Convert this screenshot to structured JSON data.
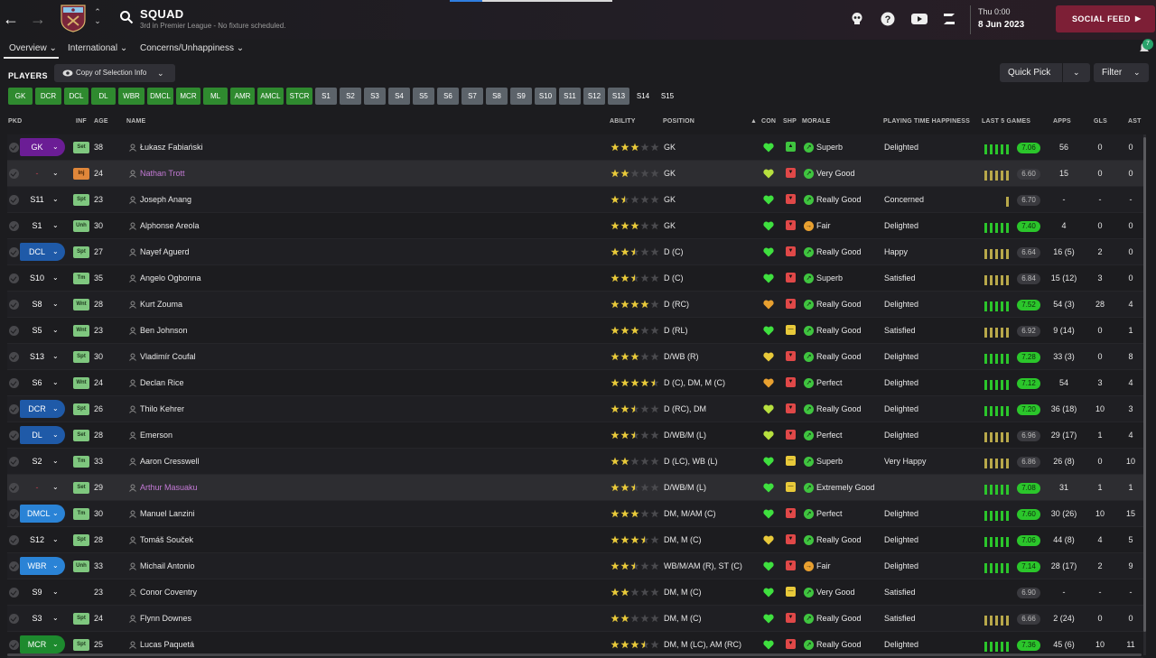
{
  "header": {
    "title": "SQUAD",
    "subtitle": "3rd in Premier League - No fixture scheduled.",
    "day": "Thu 0:00",
    "date": "8 Jun 2023",
    "social_feed": "SOCIAL FEED",
    "notifications_count": "7"
  },
  "tabs": [
    "Overview",
    "International",
    "Concerns/Unhappiness"
  ],
  "toolbar": {
    "players_label": "PLAYERS",
    "selection_info": "Copy of Selection Info",
    "quick_pick": "Quick Pick",
    "filter": "Filter"
  },
  "position_chips": [
    {
      "label": "GK",
      "style": "green"
    },
    {
      "label": "DCR",
      "style": "green"
    },
    {
      "label": "DCL",
      "style": "green"
    },
    {
      "label": "DL",
      "style": "green"
    },
    {
      "label": "WBR",
      "style": "green"
    },
    {
      "label": "DMCL",
      "style": "green"
    },
    {
      "label": "MCR",
      "style": "green"
    },
    {
      "label": "ML",
      "style": "green"
    },
    {
      "label": "AMR",
      "style": "green"
    },
    {
      "label": "AMCL",
      "style": "green"
    },
    {
      "label": "STCR",
      "style": "green"
    },
    {
      "label": "S1",
      "style": "grey"
    },
    {
      "label": "S2",
      "style": "grey"
    },
    {
      "label": "S3",
      "style": "grey"
    },
    {
      "label": "S4",
      "style": "grey"
    },
    {
      "label": "S5",
      "style": "grey"
    },
    {
      "label": "S6",
      "style": "grey"
    },
    {
      "label": "S7",
      "style": "grey"
    },
    {
      "label": "S8",
      "style": "grey"
    },
    {
      "label": "S9",
      "style": "grey"
    },
    {
      "label": "S10",
      "style": "grey"
    },
    {
      "label": "S11",
      "style": "grey"
    },
    {
      "label": "S12",
      "style": "grey"
    },
    {
      "label": "S13",
      "style": "grey"
    },
    {
      "label": "S14",
      "style": "dark"
    },
    {
      "label": "S15",
      "style": "dark"
    }
  ],
  "columns": {
    "pkd": "PKD",
    "inf": "INF",
    "age": "AGE",
    "name": "NAME",
    "ability": "ABILITY",
    "position": "POSITION",
    "con": "CON",
    "shp": "SHP",
    "morale": "MORALE",
    "happiness": "PLAYING TIME HAPPINESS",
    "last5": "LAST 5 GAMES",
    "apps": "APPS",
    "gls": "GLS",
    "ast": "AST"
  },
  "colors": {
    "green": "#2bc62b",
    "social": "#7d1f36",
    "gk_slot": "#6b1d95",
    "def_slot": "#1f5aa8",
    "wb_slot": "#2a83d6",
    "mid_slot": "#1d8a2e",
    "unavailable_name": "#c47ad6"
  },
  "players": [
    {
      "pkd": "GK",
      "pkd_style": "gk",
      "inf": "Set",
      "age": "38",
      "name": "Łukasz Fabiański",
      "stars": 3,
      "position": "GK",
      "con": "green",
      "shp": "green",
      "morale_icon": "green",
      "morale": "Superb",
      "happiness": "Delighted",
      "form": [
        "g",
        "g",
        "g",
        "g",
        "g"
      ],
      "rating": "7.06",
      "rating_style": "green",
      "apps": "56",
      "gls": "0",
      "ast": "0",
      "name_style": "normal"
    },
    {
      "pkd": "-",
      "pkd_style": "plain",
      "inf": "Inj",
      "age": "24",
      "name": "Nathan Trott",
      "stars": 2,
      "position": "GK",
      "con": "yellowgreen",
      "shp": "red",
      "morale_icon": "green",
      "morale": "Very Good",
      "happiness": "",
      "form": [
        "y",
        "y",
        "y",
        "y",
        "y"
      ],
      "rating": "6.60",
      "rating_style": "grey",
      "apps": "15",
      "gls": "0",
      "ast": "0",
      "name_style": "unavail",
      "row_style": "highlight"
    },
    {
      "pkd": "S11",
      "pkd_style": "plain",
      "inf": "Spt",
      "age": "23",
      "name": "Joseph Anang",
      "stars": 1.5,
      "position": "GK",
      "con": "green",
      "shp": "red",
      "morale_icon": "green",
      "morale": "Really Good",
      "happiness": "Concerned",
      "form": [
        "y"
      ],
      "rating": "6.70",
      "rating_style": "grey",
      "apps": "-",
      "gls": "-",
      "ast": "-",
      "name_style": "normal"
    },
    {
      "pkd": "S1",
      "pkd_style": "plain",
      "inf": "Unh",
      "age": "30",
      "name": "Alphonse Areola",
      "stars": 3,
      "position": "GK",
      "con": "green",
      "shp": "red",
      "morale_icon": "orange",
      "morale": "Fair",
      "happiness": "Delighted",
      "form": [
        "g",
        "g",
        "g",
        "g",
        "g"
      ],
      "rating": "7.40",
      "rating_style": "green",
      "apps": "4",
      "gls": "0",
      "ast": "0",
      "name_style": "normal"
    },
    {
      "pkd": "DCL",
      "pkd_style": "def",
      "inf": "Spt",
      "age": "27",
      "name": "Nayef Aguerd",
      "stars": 2.5,
      "position": "D (C)",
      "con": "green",
      "shp": "red",
      "morale_icon": "green",
      "morale": "Really Good",
      "happiness": "Happy",
      "form": [
        "y",
        "y",
        "y",
        "y",
        "y"
      ],
      "rating": "6.64",
      "rating_style": "grey",
      "apps": "16 (5)",
      "gls": "2",
      "ast": "0",
      "name_style": "normal"
    },
    {
      "pkd": "S10",
      "pkd_style": "plain",
      "inf": "Tm",
      "age": "35",
      "name": "Angelo Ogbonna",
      "stars": 2.5,
      "position": "D (C)",
      "con": "green",
      "shp": "red",
      "morale_icon": "green",
      "morale": "Superb",
      "happiness": "Satisfied",
      "form": [
        "y",
        "y",
        "y",
        "y",
        "y"
      ],
      "rating": "6.84",
      "rating_style": "grey",
      "apps": "15 (12)",
      "gls": "3",
      "ast": "0",
      "name_style": "normal"
    },
    {
      "pkd": "S8",
      "pkd_style": "plain",
      "inf": "Wnt",
      "age": "28",
      "name": "Kurt Zouma",
      "stars": 4,
      "position": "D (RC)",
      "con": "orange",
      "shp": "red",
      "morale_icon": "green",
      "morale": "Really Good",
      "happiness": "Delighted",
      "form": [
        "g",
        "g",
        "g",
        "g",
        "g"
      ],
      "rating": "7.52",
      "rating_style": "green",
      "apps": "54 (3)",
      "gls": "28",
      "ast": "4",
      "name_style": "normal"
    },
    {
      "pkd": "S5",
      "pkd_style": "plain",
      "inf": "Wnt",
      "age": "23",
      "name": "Ben Johnson",
      "stars": 3,
      "position": "D (RL)",
      "con": "green",
      "shp": "yellow",
      "morale_icon": "green",
      "morale": "Really Good",
      "happiness": "Satisfied",
      "form": [
        "y",
        "y",
        "y",
        "y",
        "y"
      ],
      "rating": "6.92",
      "rating_style": "grey",
      "apps": "9 (14)",
      "gls": "0",
      "ast": "1",
      "name_style": "normal"
    },
    {
      "pkd": "S13",
      "pkd_style": "plain",
      "inf": "Spt",
      "age": "30",
      "name": "Vladimír Coufal",
      "stars": 3,
      "position": "D/WB (R)",
      "con": "yellow",
      "shp": "red",
      "morale_icon": "green",
      "morale": "Really Good",
      "happiness": "Delighted",
      "form": [
        "g",
        "g",
        "g",
        "g",
        "g"
      ],
      "rating": "7.28",
      "rating_style": "green",
      "apps": "33 (3)",
      "gls": "0",
      "ast": "8",
      "name_style": "normal"
    },
    {
      "pkd": "S6",
      "pkd_style": "plain",
      "inf": "Wnt",
      "age": "24",
      "name": "Declan Rice",
      "stars": 4.5,
      "position": "D (C), DM, M (C)",
      "con": "orange",
      "shp": "red",
      "morale_icon": "green",
      "morale": "Perfect",
      "happiness": "Delighted",
      "form": [
        "g",
        "g",
        "g",
        "g",
        "g"
      ],
      "rating": "7.12",
      "rating_style": "green",
      "apps": "54",
      "gls": "3",
      "ast": "4",
      "name_style": "normal"
    },
    {
      "pkd": "DCR",
      "pkd_style": "def",
      "inf": "Spt",
      "age": "26",
      "name": "Thilo Kehrer",
      "stars": 2.5,
      "position": "D (RC), DM",
      "con": "yellowgreen",
      "shp": "red",
      "morale_icon": "green",
      "morale": "Really Good",
      "happiness": "Delighted",
      "form": [
        "g",
        "g",
        "g",
        "g",
        "g"
      ],
      "rating": "7.20",
      "rating_style": "green",
      "apps": "36 (18)",
      "gls": "10",
      "ast": "3",
      "name_style": "normal"
    },
    {
      "pkd": "DL",
      "pkd_style": "def",
      "inf": "Set",
      "age": "28",
      "name": "Emerson",
      "stars": 2.5,
      "position": "D/WB/M (L)",
      "con": "yellowgreen",
      "shp": "red",
      "morale_icon": "green",
      "morale": "Perfect",
      "happiness": "Delighted",
      "form": [
        "y",
        "y",
        "y",
        "y",
        "y"
      ],
      "rating": "6.96",
      "rating_style": "grey",
      "apps": "29 (17)",
      "gls": "1",
      "ast": "4",
      "name_style": "normal"
    },
    {
      "pkd": "S2",
      "pkd_style": "plain",
      "inf": "Tm",
      "age": "33",
      "name": "Aaron Cresswell",
      "stars": 2,
      "position": "D (LC), WB (L)",
      "con": "green",
      "shp": "yellow",
      "morale_icon": "green",
      "morale": "Superb",
      "happiness": "Very Happy",
      "form": [
        "y",
        "y",
        "y",
        "y",
        "y"
      ],
      "rating": "6.86",
      "rating_style": "grey",
      "apps": "26 (8)",
      "gls": "0",
      "ast": "10",
      "name_style": "normal"
    },
    {
      "pkd": "-",
      "pkd_style": "plain",
      "inf": "Set",
      "age": "29",
      "name": "Arthur Masuaku",
      "stars": 2.5,
      "position": "D/WB/M (L)",
      "con": "green",
      "shp": "yellow",
      "morale_icon": "green",
      "morale": "Extremely Good",
      "happiness": "",
      "form": [
        "g",
        "g",
        "g",
        "g",
        "g"
      ],
      "rating": "7.08",
      "rating_style": "green",
      "apps": "31",
      "gls": "1",
      "ast": "1",
      "name_style": "unavail",
      "row_style": "highlight"
    },
    {
      "pkd": "DMCL",
      "pkd_style": "wb",
      "inf": "Tm",
      "age": "30",
      "name": "Manuel Lanzini",
      "stars": 3,
      "position": "DM, M/AM (C)",
      "con": "green",
      "shp": "red",
      "morale_icon": "green",
      "morale": "Perfect",
      "happiness": "Delighted",
      "form": [
        "g",
        "g",
        "g",
        "g",
        "g"
      ],
      "rating": "7.60",
      "rating_style": "green",
      "apps": "30 (26)",
      "gls": "10",
      "ast": "15",
      "name_style": "normal"
    },
    {
      "pkd": "S12",
      "pkd_style": "plain",
      "inf": "Spt",
      "age": "28",
      "name": "Tomáš Souček",
      "stars": 3.5,
      "position": "DM, M (C)",
      "con": "yellow",
      "shp": "red",
      "morale_icon": "green",
      "morale": "Really Good",
      "happiness": "Delighted",
      "form": [
        "g",
        "g",
        "g",
        "g",
        "g"
      ],
      "rating": "7.06",
      "rating_style": "green",
      "apps": "44 (8)",
      "gls": "4",
      "ast": "5",
      "name_style": "normal"
    },
    {
      "pkd": "WBR",
      "pkd_style": "wb",
      "inf": "Unh",
      "age": "33",
      "name": "Michail Antonio",
      "stars": 2.5,
      "position": "WB/M/AM (R), ST (C)",
      "con": "green",
      "shp": "red",
      "morale_icon": "orange",
      "morale": "Fair",
      "happiness": "Delighted",
      "form": [
        "g",
        "g",
        "g",
        "g",
        "g"
      ],
      "rating": "7.14",
      "rating_style": "green",
      "apps": "28 (17)",
      "gls": "2",
      "ast": "9",
      "name_style": "normal"
    },
    {
      "pkd": "S9",
      "pkd_style": "plain",
      "inf": "",
      "age": "23",
      "name": "Conor Coventry",
      "stars": 2,
      "position": "DM, M (C)",
      "con": "green",
      "shp": "yellow",
      "morale_icon": "green",
      "morale": "Very Good",
      "happiness": "Satisfied",
      "form": [],
      "rating": "6.90",
      "rating_style": "grey",
      "apps": "-",
      "gls": "-",
      "ast": "-",
      "name_style": "normal"
    },
    {
      "pkd": "S3",
      "pkd_style": "plain",
      "inf": "Spt",
      "age": "24",
      "name": "Flynn Downes",
      "stars": 2,
      "position": "DM, M (C)",
      "con": "green",
      "shp": "red",
      "morale_icon": "green",
      "morale": "Really Good",
      "happiness": "Satisfied",
      "form": [
        "y",
        "y",
        "y",
        "y",
        "y"
      ],
      "rating": "6.66",
      "rating_style": "grey",
      "apps": "2 (24)",
      "gls": "0",
      "ast": "0",
      "name_style": "normal"
    },
    {
      "pkd": "MCR",
      "pkd_style": "mid",
      "inf": "Spt",
      "age": "25",
      "name": "Lucas Paquetá",
      "stars": 3.5,
      "position": "DM, M (LC), AM (RC)",
      "con": "green",
      "shp": "red",
      "morale_icon": "green",
      "morale": "Really Good",
      "happiness": "Delighted",
      "form": [
        "g",
        "g",
        "g",
        "g",
        "g"
      ],
      "rating": "7.36",
      "rating_style": "green",
      "apps": "45 (6)",
      "gls": "10",
      "ast": "11",
      "name_style": "normal"
    }
  ]
}
